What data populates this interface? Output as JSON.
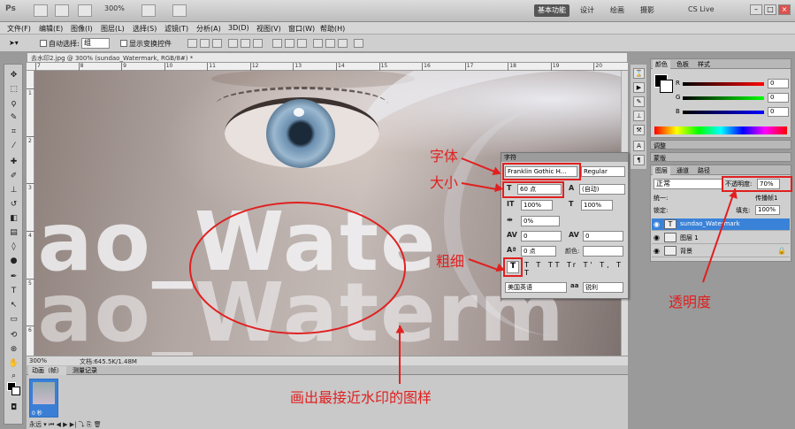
{
  "appbar": {
    "logo": "Ps",
    "zoom": "300%",
    "workspaces": [
      "基本功能",
      "设计",
      "绘画",
      "摄影"
    ],
    "cslive": "CS Live"
  },
  "menu": [
    "文件(F)",
    "编辑(E)",
    "图像(I)",
    "图层(L)",
    "选择(S)",
    "滤镜(T)",
    "分析(A)",
    "3D(D)",
    "视图(V)",
    "窗口(W)",
    "帮助(H)"
  ],
  "options": {
    "autoselect": "自动选择:",
    "group": "组",
    "transform": "显示变换控件"
  },
  "document": {
    "tab_title": "去水印2.jpg @ 300% (sundao_Watermark, RGB/8#) *",
    "watermark_line1": "lao_Wate",
    "watermark_line2": "lao_Waterm",
    "status_zoom": "300%",
    "status_doc": "文档:645.5K/1.48M",
    "ruler_top": [
      "7",
      "8",
      "9",
      "10",
      "11",
      "12",
      "13",
      "14",
      "15",
      "16",
      "17",
      "18",
      "19",
      "20"
    ],
    "ruler_left": [
      "1",
      "2",
      "3",
      "4",
      "5",
      "6"
    ]
  },
  "animation": {
    "tab1": "动画（帧）",
    "tab2": "测量记录",
    "frame_time": "0 秒",
    "loop": "永远"
  },
  "color_panel": {
    "tabs": [
      "颜色",
      "色板",
      "样式"
    ],
    "channels": [
      {
        "name": "R",
        "value": "0",
        "gradient": "#ff0000"
      },
      {
        "name": "G",
        "value": "0",
        "gradient": "#00ff00"
      },
      {
        "name": "B",
        "value": "0",
        "gradient": "#0000ff"
      }
    ]
  },
  "adjustments": {
    "title": "调整",
    "masks": "蒙版"
  },
  "layers_panel": {
    "tabs": [
      "图层",
      "通道",
      "路径"
    ],
    "blend_mode": "正常",
    "opacity_label": "不透明度:",
    "opacity_value": "70%",
    "unify": "统一:",
    "propagate": "传播帧1",
    "lock": "锁定:",
    "fill_label": "填充:",
    "fill_value": "100%",
    "layers": [
      {
        "name": "sundao_Watermark",
        "thumb": "T",
        "selected": true
      },
      {
        "name": "图层 1",
        "thumb": "",
        "selected": false
      },
      {
        "name": "背景",
        "thumb": "",
        "selected": false
      }
    ]
  },
  "character_panel": {
    "title": "字符",
    "font_family": "Franklin Gothic H...",
    "font_style": "Regular",
    "font_size": "60 点",
    "leading": "(自动)",
    "vertical_scale": "100%",
    "horizontal_scale": "100%",
    "tracking": "0%",
    "kerning": "0",
    "kerning2": "0",
    "baseline_shift": "0 点",
    "color_label": "颜色:",
    "styles": "T T TT Tr T' T, T T",
    "language": "美国英语",
    "aa": "锐利"
  },
  "annotations": {
    "font": "字体",
    "size": "大小",
    "weight": "粗细",
    "opacity": "透明度",
    "bottom": "画出最接近水印的图样"
  }
}
